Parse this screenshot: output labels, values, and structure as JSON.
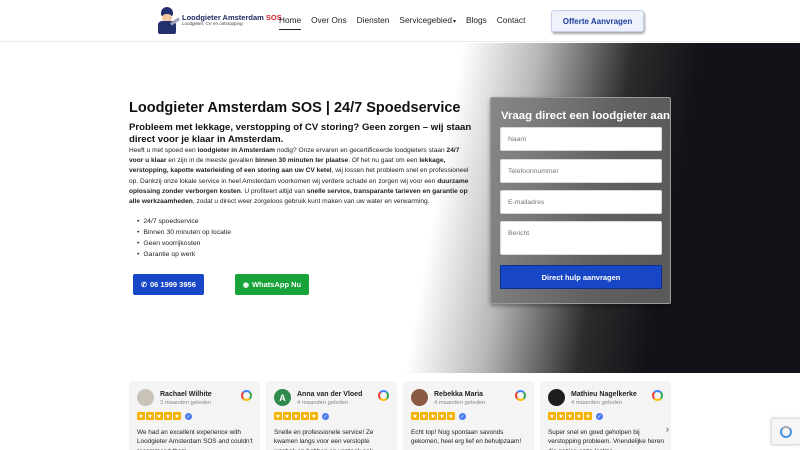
{
  "header": {
    "logo_title": "Loodgieter Amsterdam",
    "logo_title_sos": "SOS",
    "logo_subtitle": "Loodgieter, CV en ontstopping",
    "nav": [
      "Home",
      "Over Ons",
      "Diensten",
      "Servicegebied",
      "Blogs",
      "Contact"
    ],
    "nav_dropdown_icon": "chevron-down-icon",
    "quote_button": "Offerte Aanvragen"
  },
  "hero": {
    "title": "Loodgieter Amsterdam SOS | 24/7 Spoedservice",
    "subtitle": "Probleem met lekkage, verstopping of CV storing? Geen zorgen – wij staan direct voor je klaar in Amsterdam.",
    "paragraph": [
      {
        "t": "Heeft u met spoed een ",
        "b": false
      },
      {
        "t": "loodgieter in Amsterdam",
        "b": true
      },
      {
        "t": " nodig? Onze ervaren en gecertificeerde loodgieters staan ",
        "b": false
      },
      {
        "t": "24/7 voor u klaar",
        "b": true
      },
      {
        "t": " en zijn in de meeste gevallen ",
        "b": false
      },
      {
        "t": "binnen 30 minuten ter plaatse",
        "b": true
      },
      {
        "t": ". Of het nu gaat om een ",
        "b": false
      },
      {
        "t": "lekkage, verstopping, kapotte waterleiding of een storing aan uw CV ketel",
        "b": true
      },
      {
        "t": ", wij lossen het probleem snel en professioneel op. Dankzij onze lokale service in heel Amsterdam voorkomen wij verdere schade en zorgen wij voor een ",
        "b": false
      },
      {
        "t": "duurzame oplossing zonder verborgen kosten",
        "b": true
      },
      {
        "t": ". U profiteert altijd van ",
        "b": false
      },
      {
        "t": "snelle service, transparante tarieven en garantie op alle werkzaamheden",
        "b": true
      },
      {
        "t": ", zodat u direct weer zorgeloos gebruik kunt maken van uw water en verwarming.",
        "b": false
      }
    ],
    "bullets": [
      "24/7 spoedservice",
      "Binnen 30 minuten op locatie",
      "Geen voorrijkosten",
      "Garantie op werk"
    ],
    "phone_button": "06 1999 3956",
    "whatsapp_button": "WhatsApp Nu"
  },
  "form": {
    "title": "Vraag direct een loodgieter aan",
    "name_placeholder": "Naam",
    "phone_placeholder": "Telefoonnummer",
    "email_placeholder": "E-mailadres",
    "message_placeholder": "Bericht",
    "submit": "Direct hulp aanvragen"
  },
  "reviews": [
    {
      "name": "Rachael Wilhite",
      "date": "3 maanden geleden",
      "initial": "",
      "color": "#c9c2b8",
      "stars": 5,
      "text": "We had an excellent experience with Loodgieter Amsterdam SOS and couldn't recommend them"
    },
    {
      "name": "Anna van der Vloed",
      "date": "4 maanden geleden",
      "initial": "A",
      "color": "#2f8a4c",
      "stars": 5,
      "text": "Snelle en professionele service! Ze kwamen langs voor een verstopte wasbak en hebben op verzoek ook"
    },
    {
      "name": "Rebekka Maria",
      "date": "4 maanden geleden",
      "initial": "",
      "color": "#8a5a44",
      "stars": 5,
      "text": "Echt top! Nog spontaan savonds gekomen, heel erg lief en behulpzaam!"
    },
    {
      "name": "Mathieu Nagelkerke",
      "date": "4 maanden geleden",
      "initial": "",
      "color": "#1d1d1d",
      "stars": 5,
      "text": "Super snel en goed geholpen bij verstopping probleem. Vriendelijke heren die gezien onze lastige"
    }
  ],
  "colors": {
    "primary_blue": "#1746c6",
    "whatsapp_green": "#17a33a",
    "star_yellow": "#f5b301",
    "brand_navy": "#1f2b63",
    "brand_red": "#d8262c"
  }
}
